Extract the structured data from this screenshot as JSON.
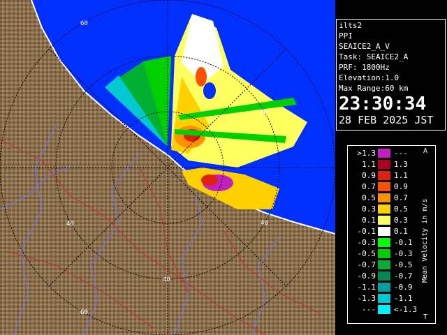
{
  "info": {
    "station": "ilts2",
    "product": "PPI",
    "volume": "SEAICE2_A_V",
    "task": "Task: SEAICE2_A",
    "prf": "PRF: 1800Hz",
    "elevation": "Elevation:1.0",
    "max_range": "Max Range:60 km",
    "time": "23:30:34",
    "date": "28 FEB 2025 JST"
  },
  "range_labels": [
    "40",
    "60"
  ],
  "legend": {
    "title": "Mean Velocity in m/s",
    "top_mark": "A",
    "bottom_mark": "T",
    "rows": [
      {
        "low": ">1.3",
        "high": "---",
        "color": "#c020c0"
      },
      {
        "low": "1.1",
        "high": "1.3",
        "color": "#b00020"
      },
      {
        "low": "0.9",
        "high": "1.1",
        "color": "#e02010"
      },
      {
        "low": "0.7",
        "high": "0.9",
        "color": "#ff5000"
      },
      {
        "low": "0.5",
        "high": "0.7",
        "color": "#ff9000"
      },
      {
        "low": "0.3",
        "high": "0.5",
        "color": "#ffd000"
      },
      {
        "low": "0.1",
        "high": "0.3",
        "color": "#ffff60"
      },
      {
        "low": "-0.1",
        "high": "0.1",
        "color": "#ffffff"
      },
      {
        "low": "-0.3",
        "high": "-0.1",
        "color": "#00ff00"
      },
      {
        "low": "-0.5",
        "high": "-0.3",
        "color": "#00d000"
      },
      {
        "low": "-0.7",
        "high": "-0.5",
        "color": "#00b030"
      },
      {
        "low": "-0.9",
        "high": "-0.7",
        "color": "#008850"
      },
      {
        "low": "-1.1",
        "high": "-0.9",
        "color": "#00a0a0"
      },
      {
        "low": "-1.3",
        "high": "-1.1",
        "color": "#00c8d0"
      },
      {
        "low": "---",
        "high": "<-1.3",
        "color": "#00f0ff"
      }
    ]
  },
  "colors": {
    "sea": "#0030ff",
    "land": "#8a6f4e",
    "land_dark": "#5a4630",
    "rivers": "#6060ff",
    "roads": "#c03030"
  }
}
